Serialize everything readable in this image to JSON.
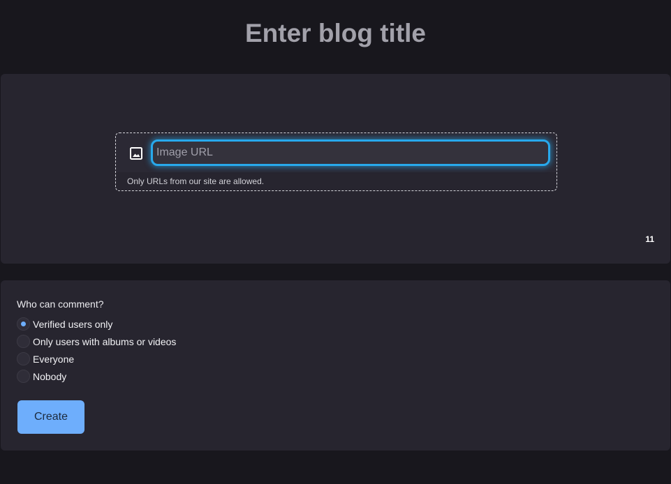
{
  "header": {
    "title": "Enter blog title"
  },
  "image_section": {
    "icon": "image-icon",
    "input_placeholder": "Image URL",
    "input_value": "",
    "hint": "Only URLs from our site are allowed.",
    "counter": "11",
    "accent_color": "#28a9ec"
  },
  "comments": {
    "question": "Who can comment?",
    "options": [
      {
        "label": "Verified users only",
        "selected": true
      },
      {
        "label": "Only users with albums or videos",
        "selected": false
      },
      {
        "label": "Everyone",
        "selected": false
      },
      {
        "label": "Nobody",
        "selected": false
      }
    ],
    "selected_color": "#6eaefc"
  },
  "actions": {
    "create_label": "Create",
    "create_color": "#6eaefc"
  }
}
